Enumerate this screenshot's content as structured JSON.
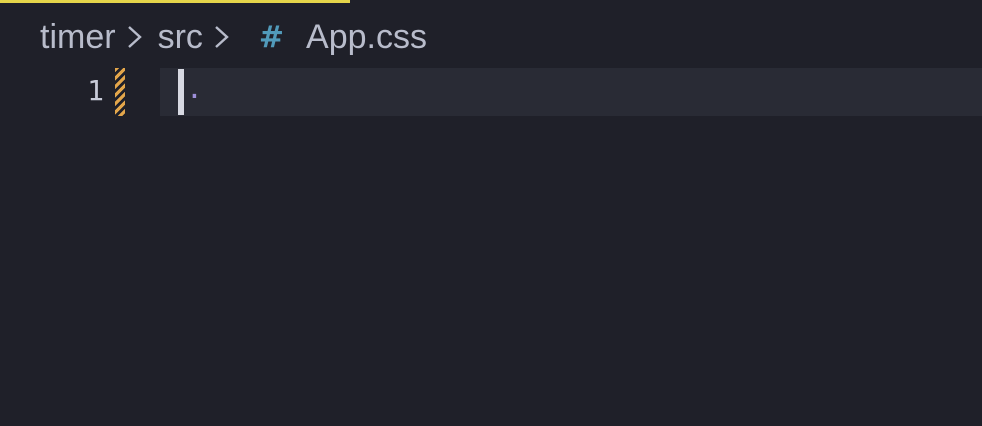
{
  "theme": {
    "background": "#1f2029",
    "current_line": "#292b35",
    "tab_accent": "#e5d54a",
    "modified_marker": "#e3a64a",
    "css_icon": "#519aba",
    "breadcrumb_text": "#b8bccb",
    "code_text": "#9d8fd9"
  },
  "breadcrumb": {
    "folder": "timer",
    "subfolder": "src",
    "file_icon_glyph": "#",
    "file_icon_name": "css-file-icon",
    "file": "App.css"
  },
  "editor": {
    "lines": [
      {
        "number": "1",
        "text": ".",
        "modified": true
      }
    ]
  }
}
